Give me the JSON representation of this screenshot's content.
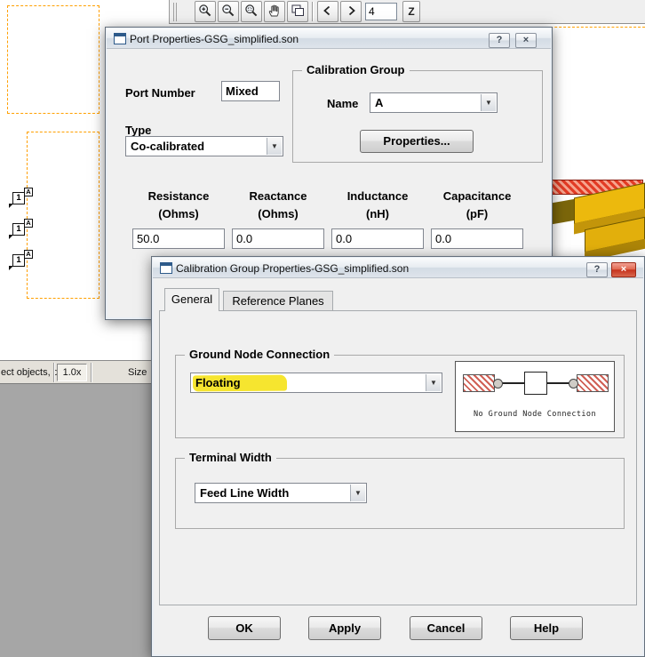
{
  "toolbar": {
    "page_number": "4",
    "z_button": "Z",
    "icons": [
      "zoom-in",
      "zoom-out",
      "zoom-area",
      "pan-hand",
      "cascade-windows",
      "page-prev",
      "page-next"
    ]
  },
  "icons": {
    "dropdown_arrow": "▼"
  },
  "window_controls": {
    "help": "?",
    "close": "×"
  },
  "status": {
    "left_text": "ect objects, d",
    "zoom": "1.0x",
    "size_label": "Size"
  },
  "canvas": {
    "port_markers": [
      {
        "num": "1",
        "sup": "A"
      },
      {
        "num": "1",
        "sup": "A"
      },
      {
        "num": "1",
        "sup": "A"
      }
    ]
  },
  "port_dialog": {
    "title": "Port Properties-GSG_simplified.son",
    "port_number_label": "Port Number",
    "port_number_value": "Mixed",
    "type_label": "Type",
    "type_value": "Co-calibrated",
    "calibration_group": {
      "legend": "Calibration Group",
      "name_label": "Name",
      "name_value": "A",
      "properties_button": "Properties..."
    },
    "columns": [
      {
        "title": "Resistance",
        "unit": "(Ohms)",
        "value": "50.0"
      },
      {
        "title": "Reactance",
        "unit": "(Ohms)",
        "value": "0.0"
      },
      {
        "title": "Inductance",
        "unit": "(nH)",
        "value": "0.0"
      },
      {
        "title": "Capacitance",
        "unit": "(pF)",
        "value": "0.0"
      }
    ]
  },
  "calib_dialog": {
    "title": "Calibration Group Properties-GSG_simplified.son",
    "tabs": [
      "General",
      "Reference Planes"
    ],
    "ground_group": {
      "legend": "Ground Node Connection",
      "dropdown_value": "Floating",
      "image_caption": "No Ground Node Connection"
    },
    "terminal_group": {
      "legend": "Terminal Width",
      "dropdown_value": "Feed Line Width"
    },
    "buttons": [
      "OK",
      "Apply",
      "Cancel",
      "Help"
    ],
    "highlight_color": "#F6E52F"
  }
}
